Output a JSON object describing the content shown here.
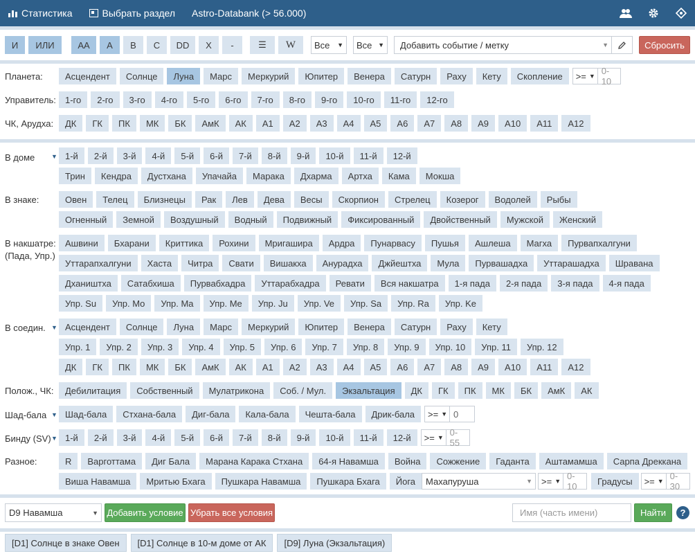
{
  "topbar": {
    "stats": "Статистика",
    "section": "Выбрать раздел",
    "db": "Astro-Databank (> 56.000)"
  },
  "toolbar": {
    "and": "И",
    "or": "ИЛИ",
    "aa": "AA",
    "a": "A",
    "b": "B",
    "c": "C",
    "dd": "DD",
    "x": "X",
    "dash": "-",
    "eq": "☰",
    "w": "W",
    "filter1": "Все",
    "filter2": "Все",
    "event_placeholder": "Добавить событие / метку",
    "reset": "Сбросить"
  },
  "planets": {
    "label": "Планета:",
    "items": [
      "Асцендент",
      "Солнце",
      "Луна",
      "Марс",
      "Меркурий",
      "Юпитер",
      "Венера",
      "Сатурн",
      "Раху",
      "Кету",
      "Скопление"
    ],
    "active": "Луна",
    "op": ">=",
    "range": "0-10"
  },
  "rulers": {
    "label": "Управитель:",
    "items": [
      "1-го",
      "2-го",
      "3-го",
      "4-го",
      "5-го",
      "6-го",
      "7-го",
      "8-го",
      "9-го",
      "10-го",
      "11-го",
      "12-го"
    ]
  },
  "ck": {
    "label": "ЧК, Арудха:",
    "items": [
      "ДК",
      "ГК",
      "ПК",
      "МК",
      "БК",
      "АмК",
      "АК",
      "А1",
      "А2",
      "А3",
      "А4",
      "А5",
      "А6",
      "А7",
      "А8",
      "А9",
      "А10",
      "А11",
      "А12"
    ]
  },
  "house": {
    "label": "В доме",
    "row1": [
      "1-й",
      "2-й",
      "3-й",
      "4-й",
      "5-й",
      "6-й",
      "7-й",
      "8-й",
      "9-й",
      "10-й",
      "11-й",
      "12-й"
    ],
    "row2": [
      "Трин",
      "Кендра",
      "Дустхана",
      "Упачайа",
      "Марака",
      "Дхарма",
      "Артха",
      "Кама",
      "Мокша"
    ]
  },
  "sign": {
    "label": "В знаке:",
    "row1": [
      "Овен",
      "Телец",
      "Близнецы",
      "Рак",
      "Лев",
      "Дева",
      "Весы",
      "Скорпион",
      "Стрелец",
      "Козерог",
      "Водолей",
      "Рыбы"
    ],
    "row2": [
      "Огненный",
      "Земной",
      "Воздушный",
      "Водный",
      "Подвижный",
      "Фиксированный",
      "Двойственный",
      "Мужской",
      "Женский"
    ]
  },
  "nakshatra": {
    "label1": "В накшатре:",
    "label2": "(Пада, Упр.)",
    "row1": [
      "Ашвини",
      "Бхарани",
      "Криттика",
      "Рохини",
      "Мригашира",
      "Ардра",
      "Пунарвасу",
      "Пушья",
      "Ашлеша",
      "Магха",
      "Пурвапхалгуни"
    ],
    "row2": [
      "Уттарапхалгуни",
      "Хаста",
      "Читра",
      "Свати",
      "Вишакха",
      "Анурадха",
      "Джйештха",
      "Мула",
      "Пурвашадха",
      "Уттарашадха",
      "Шравана"
    ],
    "row3": [
      "Дхаништха",
      "Сатабхиша",
      "Пурвабхадра",
      "Уттарабхадра",
      "Ревати",
      "Вся накшатра",
      "1-я пада",
      "2-я пада",
      "3-я пада",
      "4-я пада"
    ],
    "row4": [
      "Упр. Su",
      "Упр. Mo",
      "Упр. Ma",
      "Упр. Me",
      "Упр. Ju",
      "Упр. Ve",
      "Упр. Sa",
      "Упр. Ra",
      "Упр. Ke"
    ]
  },
  "conj": {
    "label": "В соедин.",
    "row1": [
      "Асцендент",
      "Солнце",
      "Луна",
      "Марс",
      "Меркурий",
      "Юпитер",
      "Венера",
      "Сатурн",
      "Раху",
      "Кету"
    ],
    "row2": [
      "Упр. 1",
      "Упр. 2",
      "Упр. 3",
      "Упр. 4",
      "Упр. 5",
      "Упр. 6",
      "Упр. 7",
      "Упр. 8",
      "Упр. 9",
      "Упр. 10",
      "Упр. 11",
      "Упр. 12"
    ],
    "row3": [
      "ДК",
      "ГК",
      "ПК",
      "МК",
      "БК",
      "АмК",
      "АК",
      "А1",
      "А2",
      "А3",
      "А4",
      "А5",
      "А6",
      "А7",
      "А8",
      "А9",
      "А10",
      "А11",
      "А12"
    ]
  },
  "position": {
    "label": "Полож., ЧК:",
    "items": [
      "Дебилитация",
      "Собственный",
      "Мулатрикона",
      "Соб. / Мул.",
      "Экзальтация",
      "ДК",
      "ГК",
      "ПК",
      "МК",
      "БК",
      "АмК",
      "АК"
    ],
    "active": "Экзальтация"
  },
  "shad": {
    "label": "Шад-бала",
    "items": [
      "Шад-бала",
      "Стхана-бала",
      "Диг-бала",
      "Кала-бала",
      "Чешта-бала",
      "Дрик-бала"
    ],
    "op": ">=",
    "value": "0"
  },
  "bindu": {
    "label": "Бинду (SV)",
    "items": [
      "1-й",
      "2-й",
      "3-й",
      "4-й",
      "5-й",
      "6-й",
      "7-й",
      "8-й",
      "9-й",
      "10-й",
      "11-й",
      "12-й"
    ],
    "op": ">=",
    "range": "0-55"
  },
  "misc": {
    "label": "Разное:",
    "row1": [
      "R",
      "Варготтама",
      "Диг Бала",
      "Марана Карака Стхана",
      "64-я Навамша",
      "Война",
      "Сожжение",
      "Гаданта",
      "Аштамамша",
      "Сарпа Дреккана"
    ],
    "row2": [
      "Виша Навамша",
      "Мритью Бхага",
      "Пушкара Навамша",
      "Пушкара Бхага",
      "Йога"
    ],
    "yoga_select": "Махапуруша",
    "op": ">=",
    "range": "0-10",
    "degrees": "Градусы",
    "deg_op": ">=",
    "deg_range": "0-30"
  },
  "bottom": {
    "chart_select": "D9 Навамша",
    "add": "Добавить условие",
    "remove": "Убрать все условия",
    "name_placeholder": "Имя (часть имени)",
    "find": "Найти",
    "help": "?"
  },
  "conditions": [
    "[D1] Солнце в знаке Овен",
    "[D1] Солнце в 10-м доме от АК",
    "[D9] Луна (Экзальтация)"
  ]
}
